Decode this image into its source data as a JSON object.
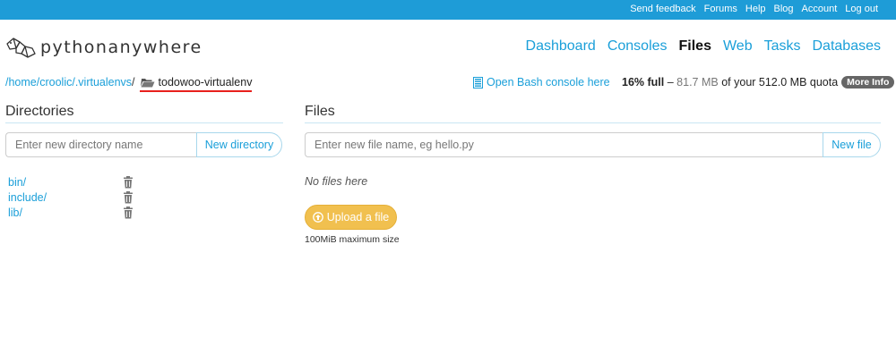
{
  "topbar": {
    "links": [
      "Send feedback",
      "Forums",
      "Help",
      "Blog",
      "Account",
      "Log out"
    ],
    "background": "#1e9cd7"
  },
  "logo": {
    "text": "pythonanywhere",
    "icon": "python-snake-logo"
  },
  "nav": {
    "items": [
      "Dashboard",
      "Consoles",
      "Files",
      "Web",
      "Tasks",
      "Databases"
    ],
    "active": "Files"
  },
  "breadcrumb": {
    "parts": [
      "/home",
      "/croolic",
      "/.virtualenvs",
      "/"
    ],
    "current": "todowoo-virtualenv",
    "current_icon": "folder-open-icon"
  },
  "bash_console": {
    "label": "Open Bash console here",
    "icon": "terminal-icon"
  },
  "quota": {
    "percent": "16% full",
    "dash": "–",
    "used": "81.7 MB",
    "of_text": "of your 512.0 MB quota",
    "more_info": "More Info"
  },
  "directories": {
    "title": "Directories",
    "input_placeholder": "Enter new directory name",
    "button": "New directory",
    "items": [
      "bin/",
      "include/",
      "lib/"
    ]
  },
  "files": {
    "title": "Files",
    "input_placeholder": "Enter new file name, eg hello.py",
    "button": "New file",
    "empty_text": "No files here",
    "upload_button": "Upload a file",
    "max_size": "100MiB maximum size"
  },
  "colors": {
    "link": "#1a9fd9",
    "upload": "#f1c04f",
    "underline": "#e8201d"
  }
}
